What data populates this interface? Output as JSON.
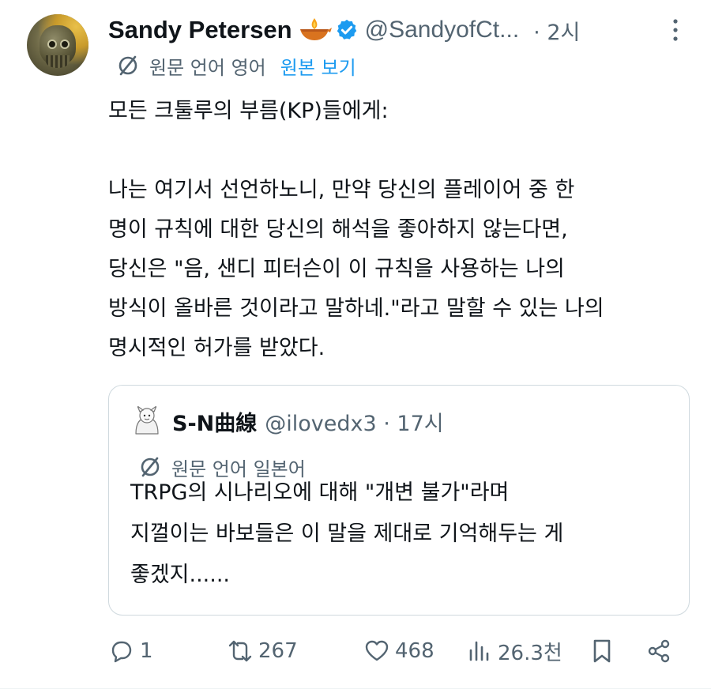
{
  "tweet": {
    "author_name": "Sandy Petersen",
    "handle": "@SandyofCt...",
    "time": "· 2시",
    "translate_label": "원문 언어 영어",
    "view_original": "원본 보기",
    "lines": [
      "모든 크툴루의 부름(KP)들에게:",
      "나는 여기서 선언하노니, 만약 당신의 플레이어 중 한",
      "명이 규칙에 대한 당신의 해석을 좋아하지 않는다면,",
      "당신은 \"음, 샌디 피터슨이 이 규칙을 사용하는 나의",
      "방식이 올바른 것이라고 말하네.\"라고 말할 수 있는 나의",
      "명시적인 허가를 받았다."
    ]
  },
  "quote": {
    "name": "S-N曲線",
    "handle": "@ilovedx3 · 17시",
    "translate_label": "원문 언어 일본어",
    "lines": [
      "TRPG의 시나리오에 대해 \"개변 불가\"라며",
      "지껄이는 바보들은 이 말을 제대로 기억해두는 게",
      "좋겠지......"
    ]
  },
  "actions": {
    "reply_count": "1",
    "retweet_count": "267",
    "like_count": "468",
    "views_count": "26.3천"
  },
  "colors": {
    "text": "#0f1419",
    "secondary": "#536471",
    "link": "#1d9bf0",
    "verified": "#1d9bf0",
    "border": "#cfd9de"
  }
}
